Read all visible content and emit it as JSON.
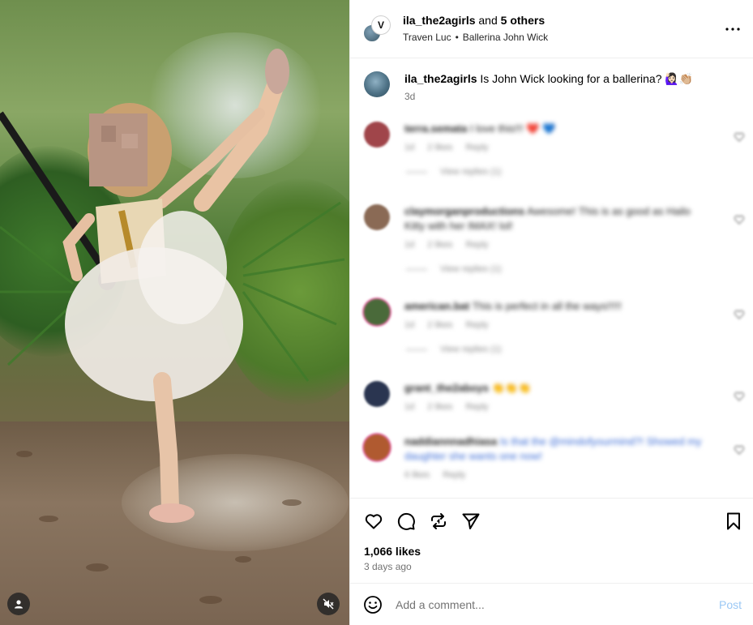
{
  "header": {
    "username": "ila_the2agirls",
    "and_text": "and",
    "others": "5 others",
    "collaborator": "Traven Luc",
    "audio": "Ballerina John Wick",
    "secondary_avatar_letter": "V"
  },
  "caption": {
    "username": "ila_the2agirls",
    "text": "Is John Wick looking for a ballerina? 🙋🏻‍♀️👏🏼",
    "time": "3d"
  },
  "comments": [
    {
      "username": "terra.semata",
      "text": "I love this!!! ❤️ 💙",
      "time": "1d",
      "likes": "2 likes",
      "reply_label": "Reply",
      "view_replies": "View replies (1)",
      "avatar_color": "#a0454a"
    },
    {
      "username": "claymorganproductions",
      "text": "Awesome! This is as good as Hailo Kitty with her IMAX! lol!",
      "time": "1d",
      "likes": "2 likes",
      "reply_label": "Reply",
      "view_replies": "View replies (1)",
      "avatar_color": "#8a6a55"
    },
    {
      "username": "american.bat",
      "text": "This is perfect in all the ways!!!!!",
      "time": "1d",
      "likes": "2 likes",
      "reply_label": "Reply",
      "view_replies": "View replies (1)",
      "avatar_color": "#4a6a3a"
    },
    {
      "username": "grant_the2aboys",
      "text": "👏👏👏",
      "time": "1d",
      "likes": "2 likes",
      "reply_label": "Reply",
      "view_replies": "",
      "avatar_color": "#2a3550"
    },
    {
      "username": "naddiannnadhiasa",
      "text": "Is that the @mindofyourmind?! Showed my daughter she wants one now!",
      "time": "6 likes",
      "likes": "",
      "reply_label": "Reply",
      "view_replies": "",
      "avatar_color": "#b05a30"
    }
  ],
  "actions": {
    "likes": "1,066 likes",
    "ago": "3 days ago"
  },
  "composer": {
    "placeholder": "Add a comment...",
    "post_label": "Post"
  },
  "colors": {
    "accent": "#0095f6",
    "post_disabled": "#9bc8f5",
    "muted": "#737373"
  }
}
